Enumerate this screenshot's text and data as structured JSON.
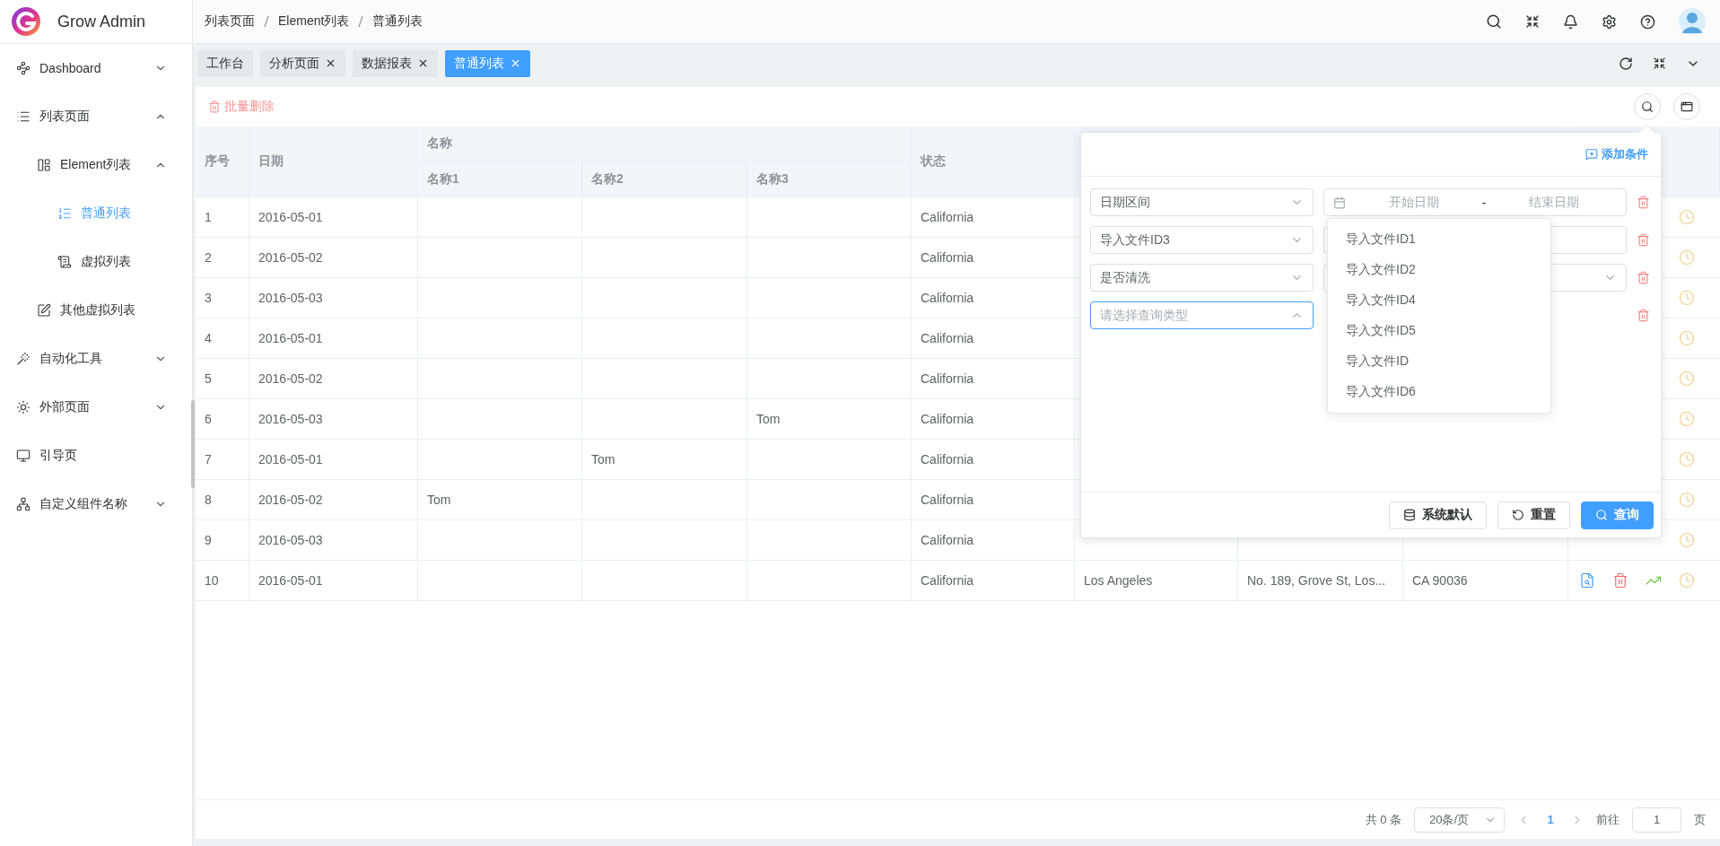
{
  "app": {
    "title": "Grow Admin"
  },
  "sidebar": {
    "items": [
      {
        "label": "Dashboard",
        "expanded": false,
        "selected": false
      },
      {
        "label": "列表页面",
        "expanded": true,
        "selected": false,
        "children": [
          {
            "label": "Element列表",
            "expanded": true,
            "selected": false,
            "children": [
              {
                "label": "普通列表",
                "selected": true
              },
              {
                "label": "虚拟列表",
                "selected": false
              }
            ]
          },
          {
            "label": "其他虚拟列表",
            "selected": false
          }
        ]
      },
      {
        "label": "自动化工具",
        "expanded": false,
        "selected": false
      },
      {
        "label": "外部页面",
        "expanded": false,
        "selected": false
      },
      {
        "label": "引导页",
        "selected": false
      },
      {
        "label": "自定义组件名称",
        "expanded": false,
        "selected": false
      }
    ]
  },
  "breadcrumb": [
    {
      "label": "列表页面"
    },
    {
      "label": "Element列表"
    },
    {
      "label": "普通列表"
    }
  ],
  "tabs": [
    {
      "label": "工作台",
      "selected": false,
      "closable": false
    },
    {
      "label": "分析页面",
      "selected": false,
      "closable": true
    },
    {
      "label": "数据报表",
      "selected": false,
      "closable": true
    },
    {
      "label": "普通列表",
      "selected": true,
      "closable": true
    }
  ],
  "toolbar": {
    "batch_delete": "批量删除"
  },
  "table": {
    "columns": [
      {
        "label": "序号"
      },
      {
        "label": "日期"
      },
      {
        "label": "名称",
        "children": [
          {
            "label": "名称1"
          },
          {
            "label": "名称2"
          },
          {
            "label": "名称3"
          }
        ]
      },
      {
        "label": "状态"
      }
    ],
    "rows": [
      {
        "index": "1",
        "date": "2016-05-01",
        "status": "California",
        "actions": [
          {
            "kind": "warning"
          }
        ]
      },
      {
        "index": "2",
        "date": "2016-05-02",
        "status": "California",
        "actions": [
          {
            "kind": "warning"
          }
        ]
      },
      {
        "index": "3",
        "date": "2016-05-03",
        "status": "California",
        "actions": [
          {
            "kind": "warning"
          }
        ]
      },
      {
        "index": "4",
        "date": "2016-05-01",
        "status": "California",
        "actions": [
          {
            "kind": "warning"
          }
        ]
      },
      {
        "index": "5",
        "date": "2016-05-02",
        "status": "California",
        "actions": [
          {
            "kind": "warning"
          }
        ]
      },
      {
        "index": "6",
        "date": "2016-05-03",
        "name_3": "Tom",
        "status": "California",
        "actions": [
          {
            "kind": "warning"
          }
        ]
      },
      {
        "index": "7",
        "date": "2016-05-01",
        "name_2": "Tom",
        "status": "California",
        "actions": [
          {
            "kind": "warning"
          }
        ]
      },
      {
        "index": "8",
        "date": "2016-05-02",
        "name_1": "Tom",
        "status": "California",
        "actions": [
          {
            "kind": "warning"
          }
        ]
      },
      {
        "index": "9",
        "date": "2016-05-03",
        "status": "California",
        "actions": [
          {
            "kind": "warning"
          }
        ]
      },
      {
        "index": "10",
        "date": "2016-05-01",
        "status": "California",
        "column_7": "Los Angeles",
        "column_8": "No. 189, Grove St, Los...",
        "column_9": "CA 90036",
        "actions": [
          {
            "kind": "view"
          },
          {
            "kind": "delete"
          },
          {
            "kind": "chart"
          },
          {
            "kind": "warning"
          }
        ]
      }
    ]
  },
  "filter_panel": {
    "add_condition": "添加条件",
    "conditions": [
      {
        "field": "日期区间",
        "open": false,
        "operand": {
          "kind": "date_range",
          "start_placeholder": "开始日期",
          "separator": "-",
          "end_placeholder": "结束日期"
        }
      },
      {
        "field": "导入文件ID3",
        "open": false,
        "operand": {
          "kind": "input"
        }
      },
      {
        "field": "是否清洗",
        "open": false,
        "operand": {
          "kind": "select"
        }
      },
      {
        "placeholder": "请选择查询类型",
        "open": true,
        "options": [
          {
            "label": "导入文件ID1"
          },
          {
            "label": "导入文件ID2"
          },
          {
            "label": "导入文件ID4"
          },
          {
            "label": "导入文件ID5"
          },
          {
            "label": "导入文件ID"
          },
          {
            "label": "导入文件ID6"
          }
        ]
      }
    ],
    "buttons": [
      {
        "label": "系统默认",
        "kind": "default"
      },
      {
        "label": "重置",
        "kind": "reset"
      },
      {
        "label": "查询",
        "kind": "primary"
      }
    ]
  },
  "pagination": {
    "total": "共 0 条",
    "page_size": "20条/页",
    "pages": [
      {
        "label": "1",
        "selected": true
      }
    ],
    "goto_label": "前往",
    "goto_value": "1",
    "page_suffix": "页"
  }
}
